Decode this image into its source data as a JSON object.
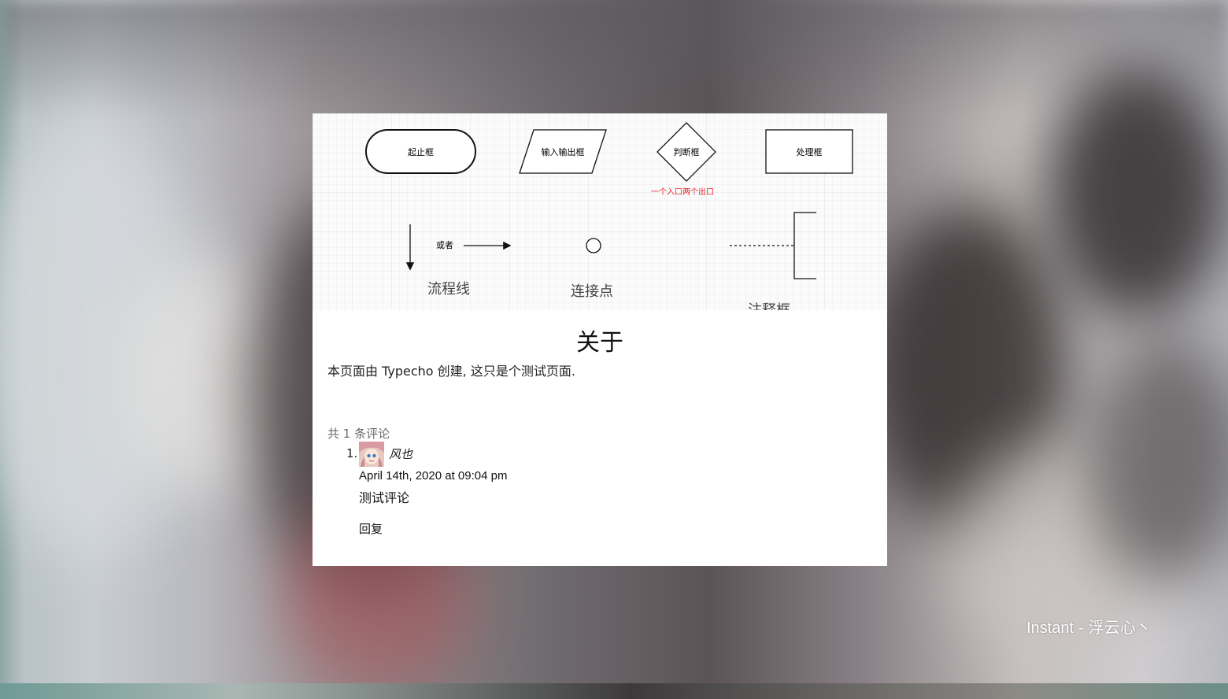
{
  "diagram": {
    "shapes": {
      "terminator": "起止框",
      "io": "输入输出框",
      "decision": "判断框",
      "decision_note": "一个入口两个出口",
      "process": "处理框",
      "or_text": "或者",
      "flowline": "流程线",
      "connector": "连接点",
      "annotation": "注释框"
    },
    "note_color": "#e8262b"
  },
  "page": {
    "title": "关于",
    "text": "本页面由 Typecho 创建, 这只是个测试页面."
  },
  "comments": {
    "count_label": "共 1 条评论",
    "items": [
      {
        "number": "1.",
        "author": "风也",
        "date": "April 14th, 2020 at 09:04 pm",
        "text": "测试评论",
        "reply": "回复"
      }
    ]
  },
  "footer": {
    "site": "Instant",
    "separator": "-",
    "owner": "浮云心丶"
  }
}
